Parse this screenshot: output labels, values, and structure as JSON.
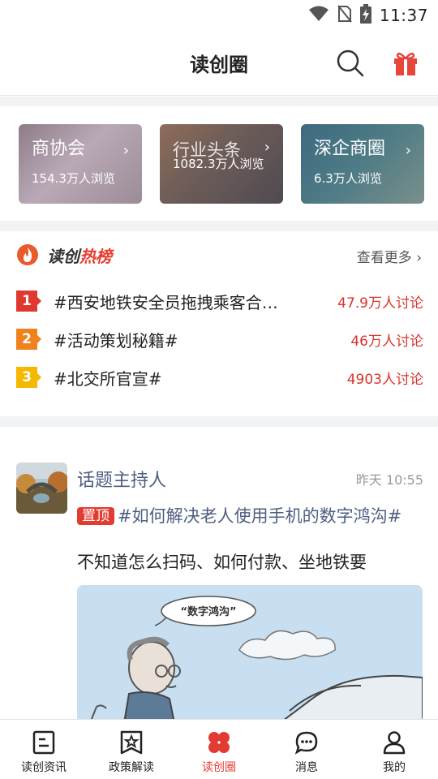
{
  "status_bar": {
    "time": "11:37",
    "icons": [
      "wifi-icon",
      "no-sim-icon",
      "battery-charging-icon"
    ]
  },
  "header": {
    "title": "读创圈",
    "icons": [
      "search-icon",
      "gift-icon"
    ],
    "gift_color": "#e8453c"
  },
  "circles": [
    {
      "name": "商协会",
      "arrow": "›",
      "views": "154.3万人浏览"
    },
    {
      "name": "行业头条",
      "arrow": "›",
      "views": "1082.3万人浏览"
    },
    {
      "name": "深企商圈",
      "arrow": "›",
      "views": "6.3万人浏览"
    }
  ],
  "hot_list": {
    "title_part1": "读创",
    "title_part2": "热榜",
    "more_label": "查看更多 ›",
    "items": [
      {
        "rank": "1",
        "topic": "#西安地铁安全员拖拽乘客合…",
        "count": "47.9万人讨论",
        "color": "#e0382f"
      },
      {
        "rank": "2",
        "topic": "#活动策划秘籍#",
        "count": "46万人讨论",
        "color": "#f0821e"
      },
      {
        "rank": "3",
        "topic": "#北交所官宣#",
        "count": "4903人讨论",
        "color": "#f5b800"
      }
    ]
  },
  "post": {
    "author": "话题主持人",
    "time": "昨天 10:55",
    "pin_label": "置顶",
    "title": "#如何解决老人使用手机的数字鸿沟#",
    "body": "不知道怎么扫码、如何付款、坐地铁要",
    "image_caption": "“数字鸿沟”"
  },
  "tabs": [
    {
      "label": "读创资讯",
      "icon": "news-icon"
    },
    {
      "label": "政策解读",
      "icon": "policy-star-icon"
    },
    {
      "label": "读创圈",
      "icon": "circle-clover-icon",
      "active": true
    },
    {
      "label": "消息",
      "icon": "message-bubble-icon"
    },
    {
      "label": "我的",
      "icon": "person-icon"
    }
  ],
  "colors": {
    "accent": "#e23b32",
    "link": "#4e5f80"
  }
}
